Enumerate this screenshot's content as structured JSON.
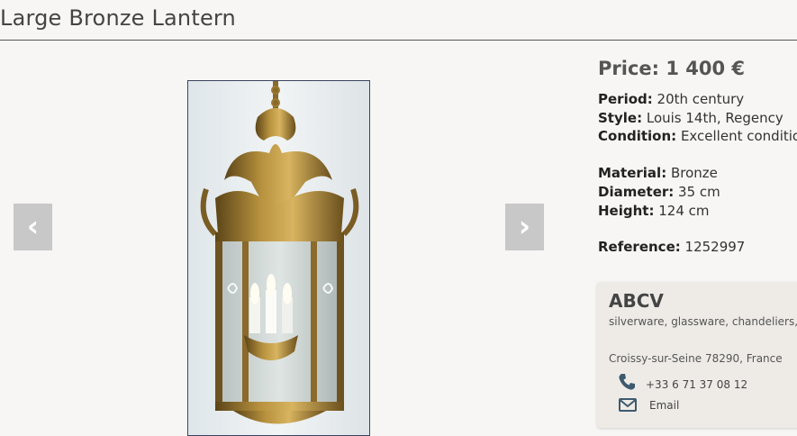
{
  "page": {
    "title": "Large Bronze Lantern"
  },
  "gallery": {
    "prev_label": "‹",
    "next_label": "›"
  },
  "details": {
    "price_label": "Price:",
    "price_value": "1 400 €",
    "period_label": "Period:",
    "period_value": "20th century",
    "style_label": "Style:",
    "style_value": "Louis 14th, Regency",
    "condition_label": "Condition:",
    "condition_value": "Excellent condition",
    "material_label": "Material:",
    "material_value": "Bronze",
    "diameter_label": "Diameter:",
    "diameter_value": "35 cm",
    "height_label": "Height:",
    "height_value": "124 cm",
    "reference_label": "Reference:",
    "reference_value": "1252997"
  },
  "dealer": {
    "name": "ABCV",
    "tags": "silverware, glassware, chandeliers, j",
    "address": "Croissy-sur-Seine 78290, France",
    "phone": "+33 6 71 37 08 12",
    "email_label": "Email"
  },
  "icons": {
    "phone": "phone-icon",
    "email": "envelope-icon"
  },
  "colors": {
    "icon": "#3d5a6e",
    "arrow_bg": "#c8c8c8"
  }
}
